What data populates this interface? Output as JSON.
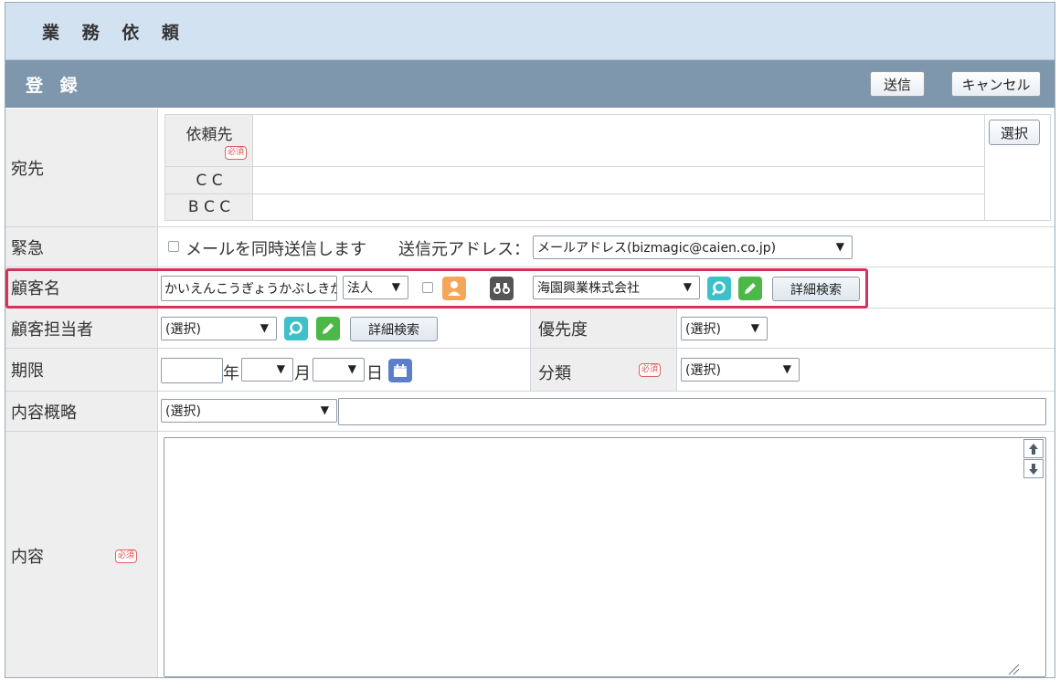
{
  "title": "業 務 依 頼",
  "section": {
    "title": "登 録",
    "send_label": "送信",
    "cancel_label": "キャンセル"
  },
  "recipients": {
    "label": "宛先",
    "request_to_label": "依頼先",
    "required_badge": "必須",
    "cc_label": "C C",
    "bcc_label": "B C C",
    "select_label": "選択"
  },
  "urgent": {
    "label": "緊急",
    "mail_checkbox_label": "メールを同時送信します",
    "sender_label": "送信元アドレス：",
    "sender_value": "メールアドレス(bizmagic@caien.co.jp)"
  },
  "customer": {
    "label": "顧客名",
    "name_input": "かいえんこうぎょうかぶしきが",
    "type_value": "法人",
    "company_value": "海園興業株式会社",
    "detail_search_label": "詳細検索"
  },
  "contact": {
    "label": "顧客担当者",
    "select_value": "(選択)",
    "detail_search_label": "詳細検索",
    "priority_label": "優先度",
    "priority_value": "(選択)"
  },
  "deadline": {
    "label": "期限",
    "year_suffix": "年",
    "month_suffix": "月",
    "day_suffix": "日",
    "category_label": "分類",
    "category_required": "必須",
    "category_value": "(選択)"
  },
  "summary": {
    "label": "内容概略",
    "select_value": "(選択)",
    "text_value": ""
  },
  "content": {
    "label": "内容",
    "required_badge": "必須",
    "text_value": ""
  },
  "colors": {
    "highlight": "#d8325a",
    "title_bg": "#d3e2f1",
    "section_bg": "#7f97ad",
    "label_bg": "#eeeeee"
  },
  "icons": [
    "arrow-down-icon",
    "person-icon",
    "binoculars-icon",
    "search-icon",
    "edit-pencil-icon",
    "calendar-icon",
    "scroll-up-icon",
    "scroll-down-icon",
    "resize-grip-icon"
  ]
}
